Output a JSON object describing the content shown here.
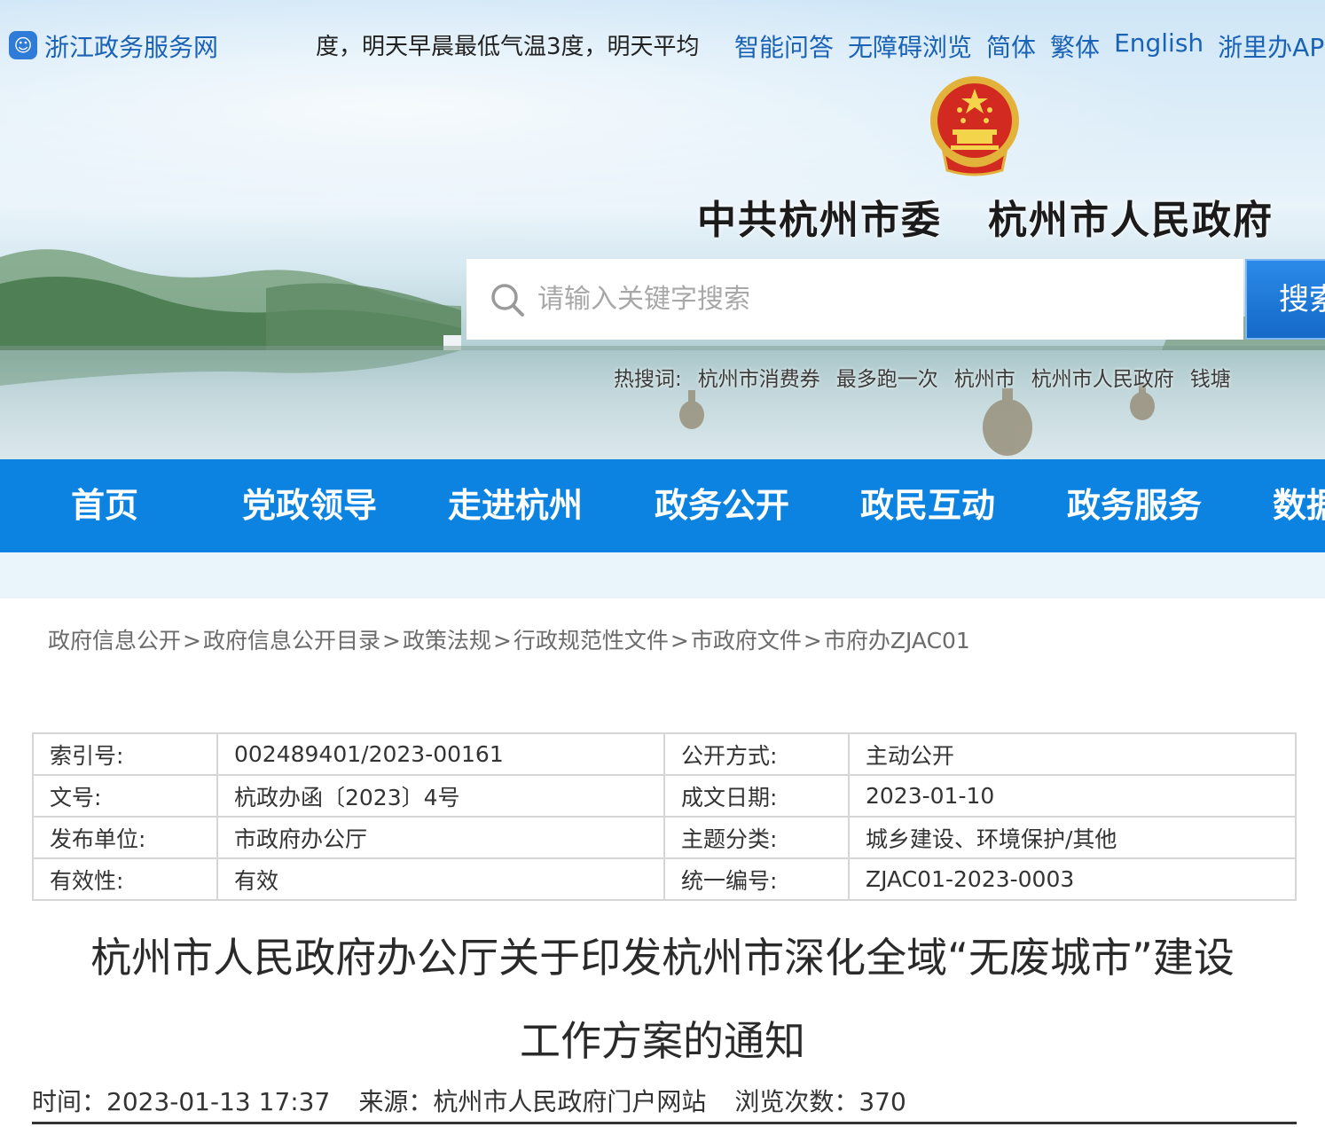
{
  "topbar": {
    "site_name": "浙江政务服务网",
    "ticker": "度，明天早晨最低气温3度，明天平均",
    "links": [
      "智能问答",
      "无障碍浏览",
      "简体",
      "繁体",
      "English",
      "浙里办APP"
    ]
  },
  "header": {
    "site_title": "中共杭州市委   杭州市人民政府"
  },
  "search": {
    "placeholder": "请输入关键字搜索",
    "button_label": "搜索",
    "hot_label": "热搜词:",
    "hot_terms": [
      "杭州市消费券",
      "最多跑一次",
      "杭州市",
      "杭州市人民政府",
      "钱塘"
    ]
  },
  "nav": {
    "items": [
      "首页",
      "党政领导",
      "走进杭州",
      "政务公开",
      "政民互动",
      "政务服务",
      "数据"
    ]
  },
  "breadcrumb": [
    "政府信息公开",
    "政府信息公开目录",
    "政策法规",
    "行政规范性文件",
    "市政府文件",
    "市府办ZJAC01"
  ],
  "meta_table": {
    "rows": [
      {
        "k1": "索引号:",
        "v1": "002489401/2023-00161",
        "k2": "公开方式:",
        "v2": "主动公开"
      },
      {
        "k1": "文号:",
        "v1": "杭政办函〔2023〕4号",
        "k2": "成文日期:",
        "v2": "2023-01-10"
      },
      {
        "k1": "发布单位:",
        "v1": "市政府办公厅",
        "k2": "主题分类:",
        "v2": "城乡建设、环境保护/其他"
      },
      {
        "k1": "有效性:",
        "v1": "有效",
        "k2": "统一编号:",
        "v2": "ZJAC01-2023-0003"
      }
    ]
  },
  "document": {
    "title_line1": "杭州市人民政府办公厅关于印发杭州市深化全域“无废城市”建设",
    "title_line2": "工作方案的通知",
    "time": "时间：2023-01-13 17:37",
    "source": "来源：杭州市人民政府门户网站",
    "views": "浏览次数：370"
  },
  "colors": {
    "nav_blue": "#0c83e1",
    "link_blue": "#1a62b5",
    "search_button": "#1569c7"
  }
}
